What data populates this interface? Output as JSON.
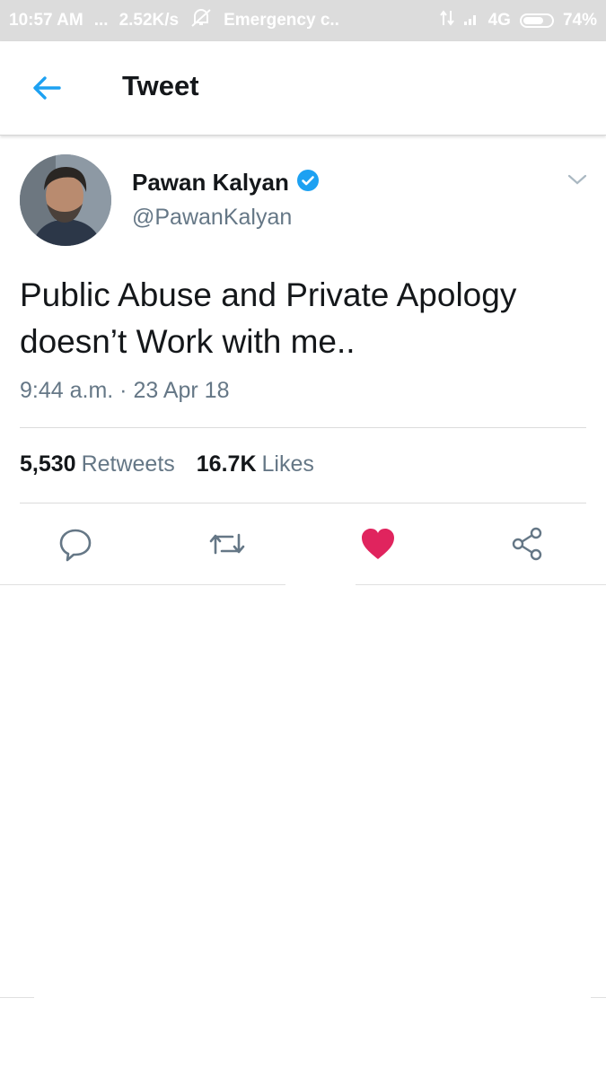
{
  "status_bar": {
    "time": "10:57 AM",
    "dots": "...",
    "speed": "2.52K/s",
    "carrier": "Emergency c..",
    "network": "4G",
    "battery": "74%",
    "battery_level": 0.74
  },
  "header": {
    "title": "Tweet",
    "back_icon": "arrow-left-icon",
    "accent_color": "#1da1f2"
  },
  "tweet": {
    "author_name": "Pawan Kalyan",
    "handle": "@PawanKalyan",
    "verified": true,
    "text_line1": "Public Abuse and Private Apology",
    "text_line2": "doesn’t Work with me..",
    "timestamp": "9:44 a.m. · 23 Apr 18",
    "retweets_count": "5,530",
    "retweets_label": "Retweets",
    "likes_count": "16.7K",
    "likes_label": "Likes",
    "liked": true,
    "like_color": "#e0245e"
  },
  "actions": [
    "reply-icon",
    "retweet-icon",
    "like-icon",
    "share-icon"
  ]
}
